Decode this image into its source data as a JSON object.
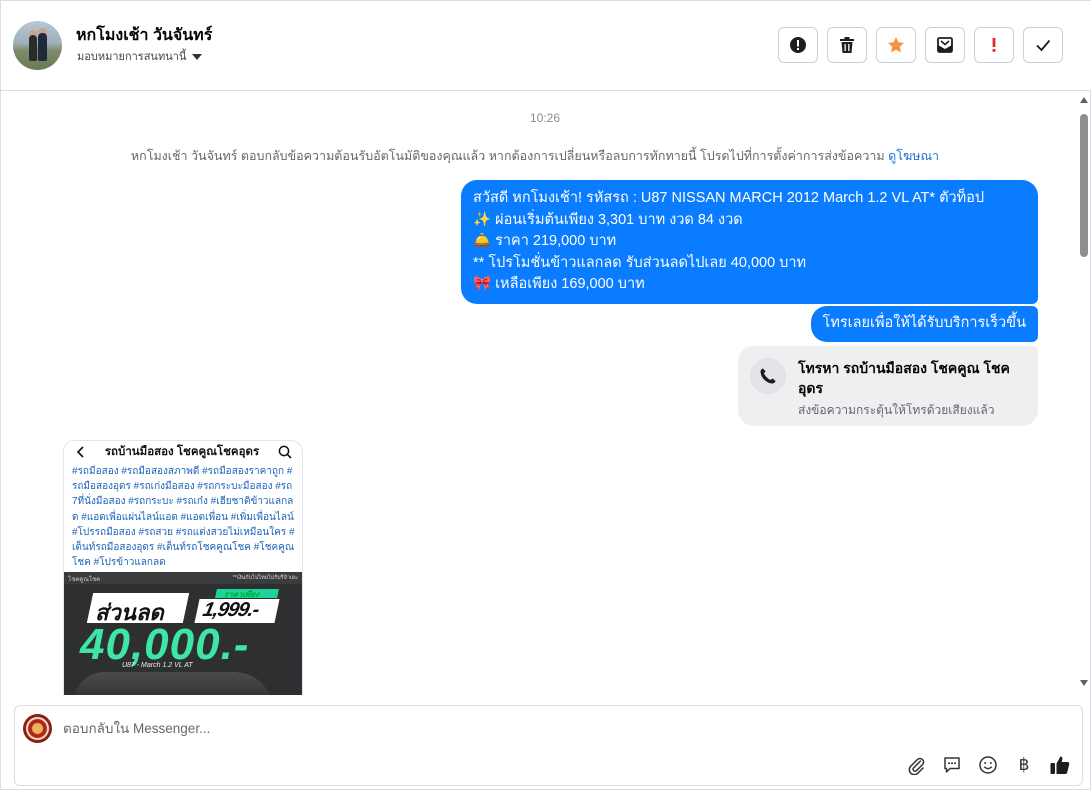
{
  "header": {
    "contact_name": "หกโมงเช้า วันจันทร์",
    "assign_label": "มอบหมายการสนทนานี้",
    "action_icons": [
      "report-icon",
      "trash-icon",
      "star-icon",
      "mark-unread-icon",
      "priority-icon",
      "done-check-icon"
    ],
    "star_color": "#f7923a"
  },
  "conversation": {
    "timestamp": "10:26",
    "system_notice": "หกโมงเช้า วันจันทร์ ตอบกลับข้อความต้อนรับอัตโนมัติของคุณแล้ว หากต้องการเปลี่ยนหรือลบการทักทายนี้ โปรดไปที่การตั้งค่าการส่งข้อความ",
    "system_notice_link": "ดูโฆษณา",
    "message_1_lines": [
      "สวัสดี หกโมงเช้า!    รหัสรถ : U87  NISSAN MARCH 2012 March 1.2 VL AT* ตัวท็อป",
      "✨  ผ่อนเริ่มต้นเพียง 3,301 บาท งวด 84 งวด",
      "🛎️ ราคา 219,000 บาท",
      "**  โปรโมชั่นข้าวแลกลด รับส่วนลดไปเลย 40,000 บาท",
      "🎀 เหลือเพียง 169,000 บาท"
    ],
    "message_2": "โทรเลยเพื่อให้ได้รับบริการเร็วขึ้น",
    "call_card": {
      "title": "โทรหา รถบ้านมือสอง โชคคูณ โชคอุดร",
      "subtitle": "ส่งข้อความกระตุ้นให้โทรด้วยเสียงแล้ว"
    },
    "outgoing_bubble_color": "#0a7cff",
    "post": {
      "page_title": "รถบ้านมือสอง โชคคูณโชคอุดร",
      "hashtags": "#รถมือสอง #รถมือสองสภาพดี #รถมือสองราคาถูก #รถมือสองอุดร #รถเก่งมือสอง #รถกระบะมือสอง #รถ7ที่นั่งมือสอง #รถกระบะ #รถเก๋ง #เฮียชาติข้าวแลกลด #แอดเพื่อแผ่นไลน์แอด #แอดเพื่อน #เพิ่มเพื่อนไลน์ #โปรรถมือสอง #รถสวย #รถแต่งสวยไม่เหมือนใคร #เต็นท์รถมือสองอุดร #เต็นท์รถโชคคูณโชค #โชคคูณโชค #โปรข้าวแลกลด",
      "banner_logo": "โชคคูณโชค",
      "banner_note": "**เงินกับไปไทยไปรับรีจ้าเยะ",
      "banner_discount": "ส่วนลด",
      "banner_price_label": "ราคาเพียง",
      "banner_price": "1,999.-",
      "banner_amount": "40,000.-",
      "banner_model": "U87 - March 1.2 VL AT",
      "accent_color": "#3ee6a6"
    }
  },
  "composer": {
    "placeholder": "ตอบกลับใน Messenger...",
    "value": "",
    "tool_icons": [
      "attachment-icon",
      "saved-reply-icon",
      "emoji-icon",
      "baht-payment-icon",
      "like-icon"
    ],
    "baht_symbol": "฿"
  }
}
